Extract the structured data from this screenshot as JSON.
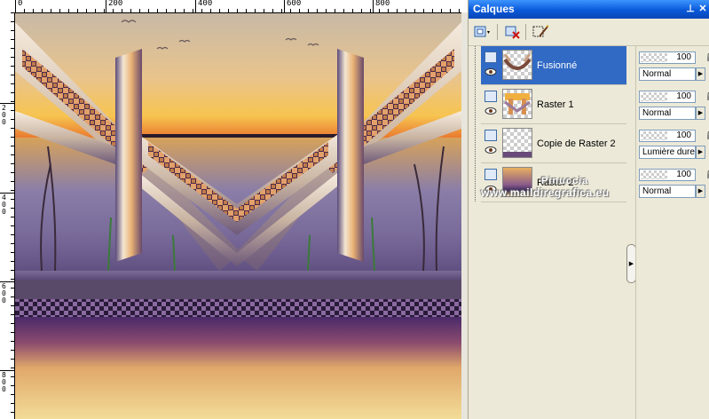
{
  "ruler": {
    "top_labels": [
      "200",
      "400",
      "600",
      "800"
    ],
    "left_labels": [
      "2 0 0",
      "4 0 0",
      "6 0 0",
      "8 0 0"
    ]
  },
  "palette": {
    "title": "Calques",
    "title_buttons": [
      "pin-icon",
      "close-icon"
    ],
    "toolbar": [
      "new-layer-icon",
      "delete-layer-icon",
      "mask-icon",
      "edit-icon"
    ],
    "layers": [
      {
        "name": "Fusionné",
        "selected": true
      },
      {
        "name": "Raster 1",
        "selected": false
      },
      {
        "name": "Copie de Raster 2",
        "selected": false
      },
      {
        "name": "Raster 2",
        "selected": false
      }
    ],
    "properties": [
      {
        "opacity": "100",
        "blend": "Normal"
      },
      {
        "opacity": "100",
        "blend": "Normal"
      },
      {
        "opacity": "100",
        "blend": "Lumière dure"
      },
      {
        "opacity": "100",
        "blend": "Normal"
      }
    ]
  },
  "watermark": {
    "line1": "Pinuccia",
    "line2": "www.maildiregrafica.eu"
  },
  "colors": {
    "title_bar": "#0a59d9",
    "selected_row": "#316ac5",
    "palette_bg": "#ece9d8"
  }
}
